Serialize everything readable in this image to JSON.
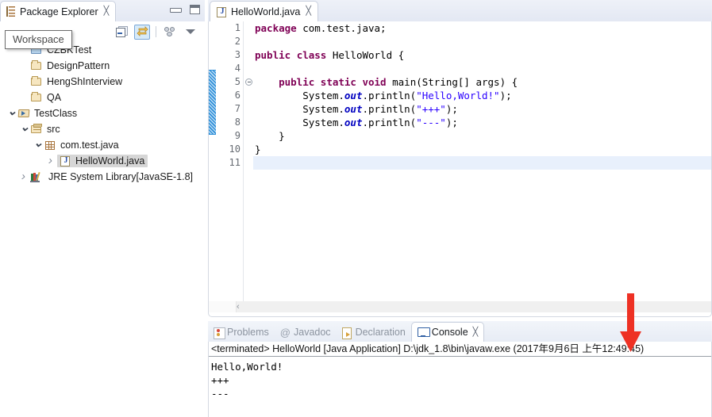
{
  "explorer": {
    "tab_label": "Package Explorer",
    "tab_close": "╳",
    "tab_icon": "package-explorer-icon",
    "window_buttons": {
      "minimize": "minimize-button",
      "maximize": "maximize-button"
    },
    "toolbar": [
      {
        "name": "collapse-all-button",
        "tooltip": "Collapse All",
        "selected": false
      },
      {
        "name": "link-with-editor-button",
        "tooltip": "Link with Editor",
        "selected": true
      },
      {
        "name": "focus-on-active-task-button",
        "tooltip": "Focus on Active Task",
        "selected": false
      },
      {
        "name": "view-menu-button",
        "tooltip": "View Menu",
        "selected": false
      }
    ],
    "tooltip": "Workspace",
    "tree": [
      {
        "label": "CZBKTest",
        "icon": "closed-project-folder-icon",
        "twisty": "none",
        "indent": 1,
        "selected": false
      },
      {
        "label": "DesignPattern",
        "icon": "closed-project-folder-icon-tan",
        "twisty": "none",
        "indent": 1,
        "selected": false
      },
      {
        "label": "HengShInterview",
        "icon": "closed-project-folder-icon-tan",
        "twisty": "none",
        "indent": 1,
        "selected": false
      },
      {
        "label": "QA",
        "icon": "closed-project-folder-icon-tan",
        "twisty": "none",
        "indent": 1,
        "selected": false
      },
      {
        "label": "TestClass",
        "icon": "open-project-folder-icon",
        "twisty": "down",
        "indent": 0,
        "selected": false
      },
      {
        "label": "src",
        "icon": "source-folder-icon",
        "twisty": "down",
        "indent": 1,
        "selected": false
      },
      {
        "label": "com.test.java",
        "icon": "package-icon",
        "twisty": "down",
        "indent": 2,
        "selected": false
      },
      {
        "label": "HelloWorld.java",
        "icon": "java-file-icon",
        "twisty": "right",
        "indent": 3,
        "selected": true
      },
      {
        "label": "JRE System Library",
        "suffix": " [JavaSE-1.8]",
        "icon": "jre-library-icon",
        "twisty": "right",
        "indent": 1,
        "selected": false
      }
    ]
  },
  "editor": {
    "tab_label": "HelloWorld.java",
    "tab_icon": "java-file-icon",
    "tab_close": "╳",
    "line_numbers": [
      "1",
      "2",
      "3",
      "4",
      "5",
      "6",
      "7",
      "8",
      "9",
      "10",
      "11"
    ],
    "fold_marker_line": 5,
    "current_line": 11,
    "lines": [
      {
        "n": 1,
        "html": "<span class=\"kw\">package</span> com.test.java;"
      },
      {
        "n": 2,
        "html": ""
      },
      {
        "n": 3,
        "html": "<span class=\"kw\">public</span> <span class=\"kw\">class</span> HelloWorld {"
      },
      {
        "n": 4,
        "html": ""
      },
      {
        "n": 5,
        "html": "    <span class=\"kw\">public</span> <span class=\"kw\">static</span> <span class=\"kw\">void</span> main(String[] args) {"
      },
      {
        "n": 6,
        "html": "        System.<span class=\"fld\">out</span>.println(<span class=\"str\">\"Hello,World!\"</span>);"
      },
      {
        "n": 7,
        "html": "        System.<span class=\"fld\">out</span>.println(<span class=\"str\">\"+++\"</span>);"
      },
      {
        "n": 8,
        "html": "        System.<span class=\"fld\">out</span>.println(<span class=\"str\">\"---\"</span>);"
      },
      {
        "n": 9,
        "html": "    }"
      },
      {
        "n": 10,
        "html": "}"
      },
      {
        "n": 11,
        "html": ""
      }
    ],
    "plain_text": [
      "package com.test.java;",
      "",
      "public class HelloWorld {",
      "",
      "    public static void main(String[] args) {",
      "        System.out.println(\"Hello,World!\");",
      "        System.out.println(\"+++\");",
      "        System.out.println(\"---\");",
      "    }",
      "}",
      ""
    ],
    "scrollbar_left_arrow": "‹"
  },
  "console": {
    "tabs": [
      {
        "label": "Problems",
        "icon": "problems-icon",
        "active": false
      },
      {
        "label": "Javadoc",
        "icon": "javadoc-icon",
        "active": false
      },
      {
        "label": "Declaration",
        "icon": "declaration-icon",
        "active": false
      },
      {
        "label": "Console",
        "icon": "console-icon",
        "active": true
      }
    ],
    "close_glyph": "╳",
    "header": "<terminated> HelloWorld [Java Application] D:\\jdk_1.8\\bin\\javaw.exe (2017年9月6日 上午12:49:45)",
    "output": [
      "Hello,World!",
      "+++",
      "---"
    ]
  },
  "annotation": {
    "arrow": "red-down-arrow",
    "color": "#ee3124"
  },
  "colors": {
    "keyword": "#7f0055",
    "string": "#2a00ff",
    "field": "#0000c0",
    "selection": "#d6d6d6",
    "current_line": "#e8f0fc",
    "tab_gradient_top": "#eef1f8",
    "tab_gradient_bottom": "#e3e8f3",
    "accent_blue": "#2e8fd8"
  }
}
